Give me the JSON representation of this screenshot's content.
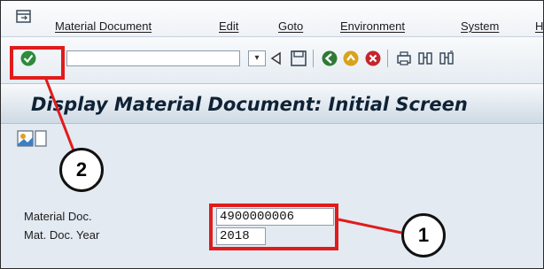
{
  "menubar": {
    "items": [
      "Material Document",
      "Edit",
      "Goto",
      "Environment",
      "System",
      "H"
    ]
  },
  "toolbar": {
    "command_field_value": "",
    "dropdown_glyph": "▾",
    "buttons": [
      "enter-check-icon",
      "back-triangle-icon",
      "save-icon",
      "back-icon",
      "exit-icon",
      "cancel-icon",
      "print-icon",
      "find-icon",
      "find-next-icon"
    ]
  },
  "title": "Display Material Document: Initial Screen",
  "form": {
    "material_doc_label": "Material Doc.",
    "material_doc_value": "4900000006",
    "doc_year_label": "Mat. Doc. Year",
    "doc_year_value": "2018"
  },
  "callouts": {
    "one": "1",
    "two": "2"
  },
  "colors": {
    "highlight": "#e11b1b",
    "enter_button": "#2e8b3a",
    "title_text": "#0f2235"
  }
}
